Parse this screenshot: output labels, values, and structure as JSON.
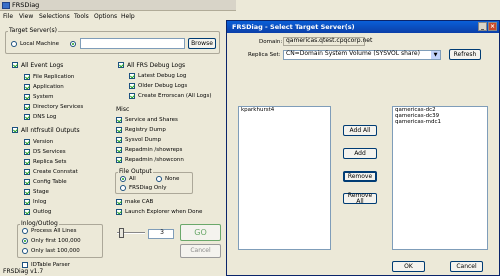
{
  "app": {
    "title": "FRSDiag",
    "status": "FRSDiag v1.7",
    "menu": [
      "File",
      "View",
      "Selections",
      "Tools",
      "Options",
      "Help"
    ]
  },
  "target": {
    "group_label": "Target Server(s)",
    "local_machine_label": "Local Machine",
    "input_value": "",
    "browse_label": "Browse"
  },
  "event_logs": {
    "label": "All Event Logs",
    "items": [
      "File Replication",
      "Application",
      "System",
      "Directory Services",
      "DNS Log"
    ]
  },
  "debug_logs": {
    "label": "All FRS Debug Logs",
    "items": [
      "Latest Debug Log",
      "Older Debug Logs",
      "Create Errorscan (All Logs)"
    ]
  },
  "ntfrsutil": {
    "label": "All ntfrsutil Outputs",
    "items": [
      "Version",
      "DS Services",
      "Replica Sets",
      "Create Connstat",
      "Config Table",
      "Stage",
      "Inlog",
      "Outlog"
    ]
  },
  "inlog_outlog": {
    "label": "Inlog/Outlog",
    "options": [
      "Process All Lines",
      "Only first 100,000",
      "Only last 100,000"
    ]
  },
  "misc": {
    "label": "Misc",
    "items": [
      "Service and Shares",
      "Registry Dump",
      "Sysvol Dump",
      "Repadmin /showreps",
      "Repadmin /showconn"
    ]
  },
  "file_output": {
    "label": "File Output",
    "options": [
      "All",
      "None",
      "FRSDiag Only"
    ]
  },
  "extra": {
    "make_cab": "make CAB",
    "launch_explorer": "Launch Explorer when Done",
    "idtable_parser": "IDTable Parser",
    "slider_value": "3",
    "go_label": "GO",
    "cancel_label": "Cancel"
  },
  "dialog": {
    "title": "FRSDiag - Select Target Server(s)",
    "domain_label": "Domain:",
    "domain_value": "qamericas.qtest.cpqcorp.net",
    "replica_label": "Replica Set:",
    "replica_value": "CN=Domain System Volume (SYSVOL share)",
    "refresh_label": "Refresh",
    "available_servers": [
      "kparkhurst4"
    ],
    "selected_servers": [
      "qamericas-dc2",
      "qamericas-dc39",
      "qamericas-mdc1"
    ],
    "add_all_label": "Add All",
    "add_label": "Add",
    "remove_label": "Remove",
    "remove_all_label": "Remove All",
    "ok_label": "OK",
    "cancel_label": "Cancel"
  }
}
